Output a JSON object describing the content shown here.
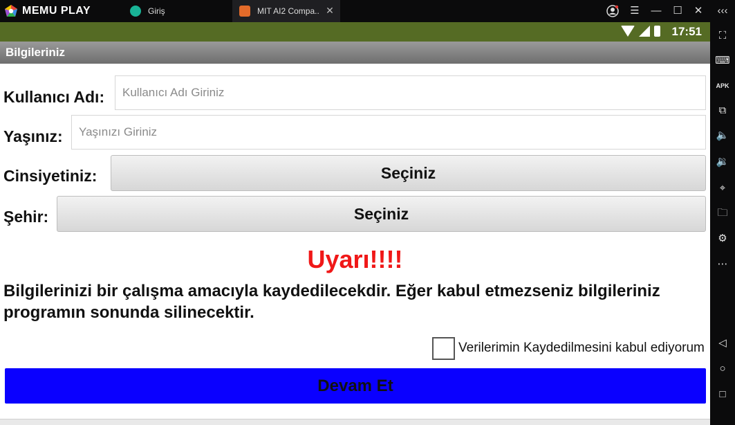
{
  "emulator": {
    "brand": "MEMU PLAY",
    "tabs": [
      {
        "label": "Giriş"
      },
      {
        "label": "MIT AI2 Compa.."
      }
    ],
    "window_controls": [
      "account",
      "menu",
      "minimize",
      "maximize",
      "close",
      "collapse"
    ],
    "side_toolbar": [
      "fullscreen-icon",
      "keyboard-icon",
      "apk-icon",
      "multi-window-icon",
      "volume-up-icon",
      "volume-down-icon",
      "location-icon",
      "folder-icon",
      "settings-icon",
      "more-icon",
      "back-icon",
      "home-icon",
      "recents-icon"
    ]
  },
  "status": {
    "time": "17:51"
  },
  "app": {
    "title": "Bilgileriniz",
    "username_label": "Kullanıcı Adı:",
    "username_placeholder": "Kullanıcı Adı Giriniz",
    "age_label": "Yaşınız:",
    "age_placeholder": "Yaşınızı Giriniz",
    "gender_label": "Cinsiyetiniz:",
    "gender_value": "Seçiniz",
    "city_label": "Şehir:",
    "city_value": "Seçiniz",
    "warning_title": "Uyarı!!!!",
    "warning_text": "Bilgilerinizi bir çalışma amacıyla kaydedilecekdir. Eğer kabul etmezseniz bilgileriniz programın sonunda silinecektir.",
    "consent_label": "Verilerimin Kaydedilmesini kabul ediyorum",
    "continue_label": "Devam Et"
  },
  "colors": {
    "statusbar": "#556b24",
    "warning": "#f01818",
    "continue_button": "#0a00ff"
  }
}
